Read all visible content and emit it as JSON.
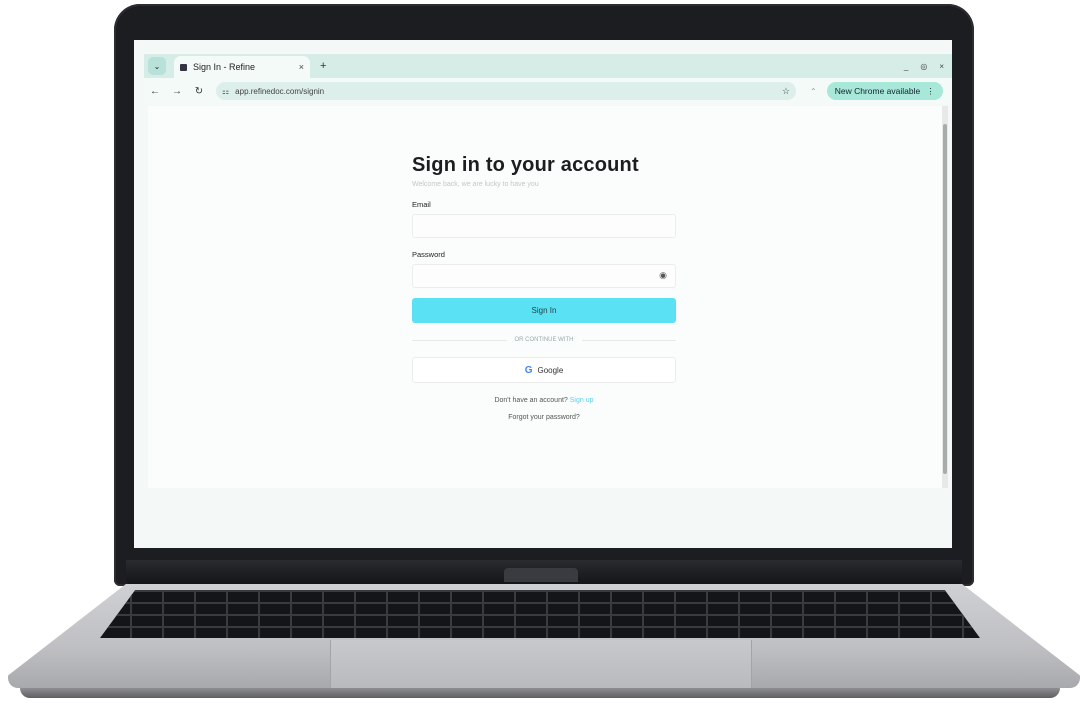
{
  "browser": {
    "tab_title": "Sign In - Refine",
    "tab_close": "×",
    "new_tab": "+",
    "window_controls": [
      "_",
      "◎",
      "×"
    ],
    "url": "app.refinedoc.com/signin",
    "update_label": "New Chrome available"
  },
  "signin": {
    "title": "Sign in to your account",
    "subtitle": "Welcome back, we are lucky to have you",
    "email_label": "Email",
    "password_label": "Password",
    "submit_label": "Sign In",
    "divider_text": "OR CONTINUE WITH",
    "google_label": "Google",
    "no_account_text": "Don't have an account?",
    "signup_link": "Sign up",
    "forgot_label": "Forgot your password?"
  },
  "colors": {
    "primary_button": "#5ae1f4",
    "tabbar": "#d5ece7",
    "update_pill": "#a7e8d8"
  }
}
